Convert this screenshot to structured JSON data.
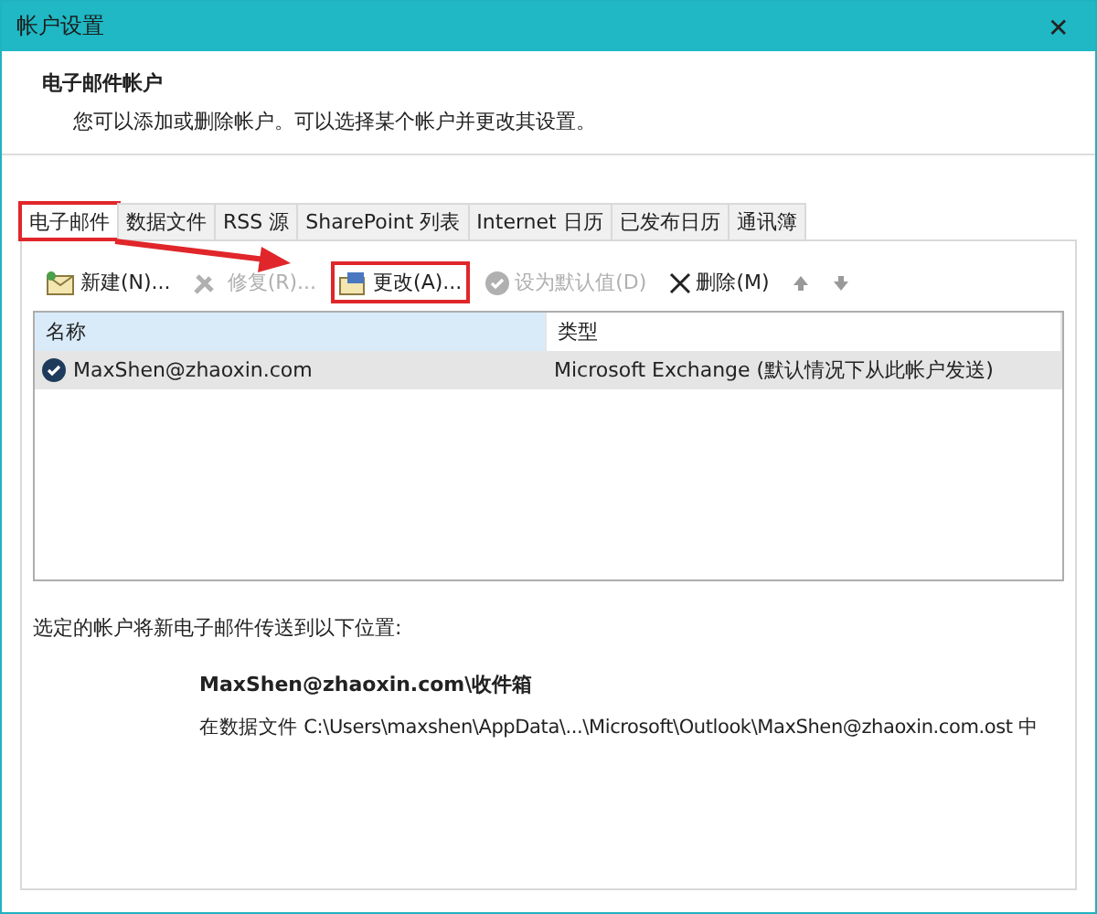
{
  "window": {
    "title": "帐户设置",
    "close": "✕"
  },
  "header": {
    "title": "电子邮件帐户",
    "description": "您可以添加或删除帐户。可以选择某个帐户并更改其设置。"
  },
  "tabs": [
    {
      "label": "电子邮件",
      "selected": true,
      "annotated": true
    },
    {
      "label": "数据文件",
      "selected": false,
      "annotated": false
    },
    {
      "label": "RSS 源",
      "selected": false,
      "annotated": false
    },
    {
      "label": "SharePoint 列表",
      "selected": false,
      "annotated": false
    },
    {
      "label": "Internet 日历",
      "selected": false,
      "annotated": false
    },
    {
      "label": "已发布日历",
      "selected": false,
      "annotated": false
    },
    {
      "label": "通讯簿",
      "selected": false,
      "annotated": false
    }
  ],
  "toolbar": [
    {
      "kind": "new",
      "label": "新建(N)...",
      "disabled": false,
      "annotated": false
    },
    {
      "kind": "repair",
      "label": "修复(R)...",
      "disabled": true,
      "annotated": false
    },
    {
      "kind": "change",
      "label": "更改(A)...",
      "disabled": false,
      "annotated": true
    },
    {
      "kind": "default",
      "label": "设为默认值(D)",
      "disabled": true,
      "annotated": false
    },
    {
      "kind": "delete",
      "label": "删除(M)",
      "disabled": false,
      "annotated": false
    },
    {
      "kind": "up",
      "disabled": false,
      "annotated": false
    },
    {
      "kind": "down",
      "disabled": false,
      "annotated": false
    }
  ],
  "table": {
    "columns": [
      {
        "label": "名称",
        "sorted": true
      },
      {
        "label": "类型",
        "sorted": false
      }
    ],
    "rows": [
      {
        "name": "MaxShen@zhaoxin.com",
        "type": "Microsoft Exchange (默认情况下从此帐户发送)",
        "selected": true,
        "default": true
      }
    ]
  },
  "delivery": {
    "label": "选定的帐户将新电子邮件传送到以下位置:",
    "folder": "MaxShen@zhaoxin.com\\收件箱",
    "path": "在数据文件 C:\\Users\\maxshen\\AppData\\...\\Microsoft\\Outlook\\MaxShen@zhaoxin.com.ost 中"
  }
}
